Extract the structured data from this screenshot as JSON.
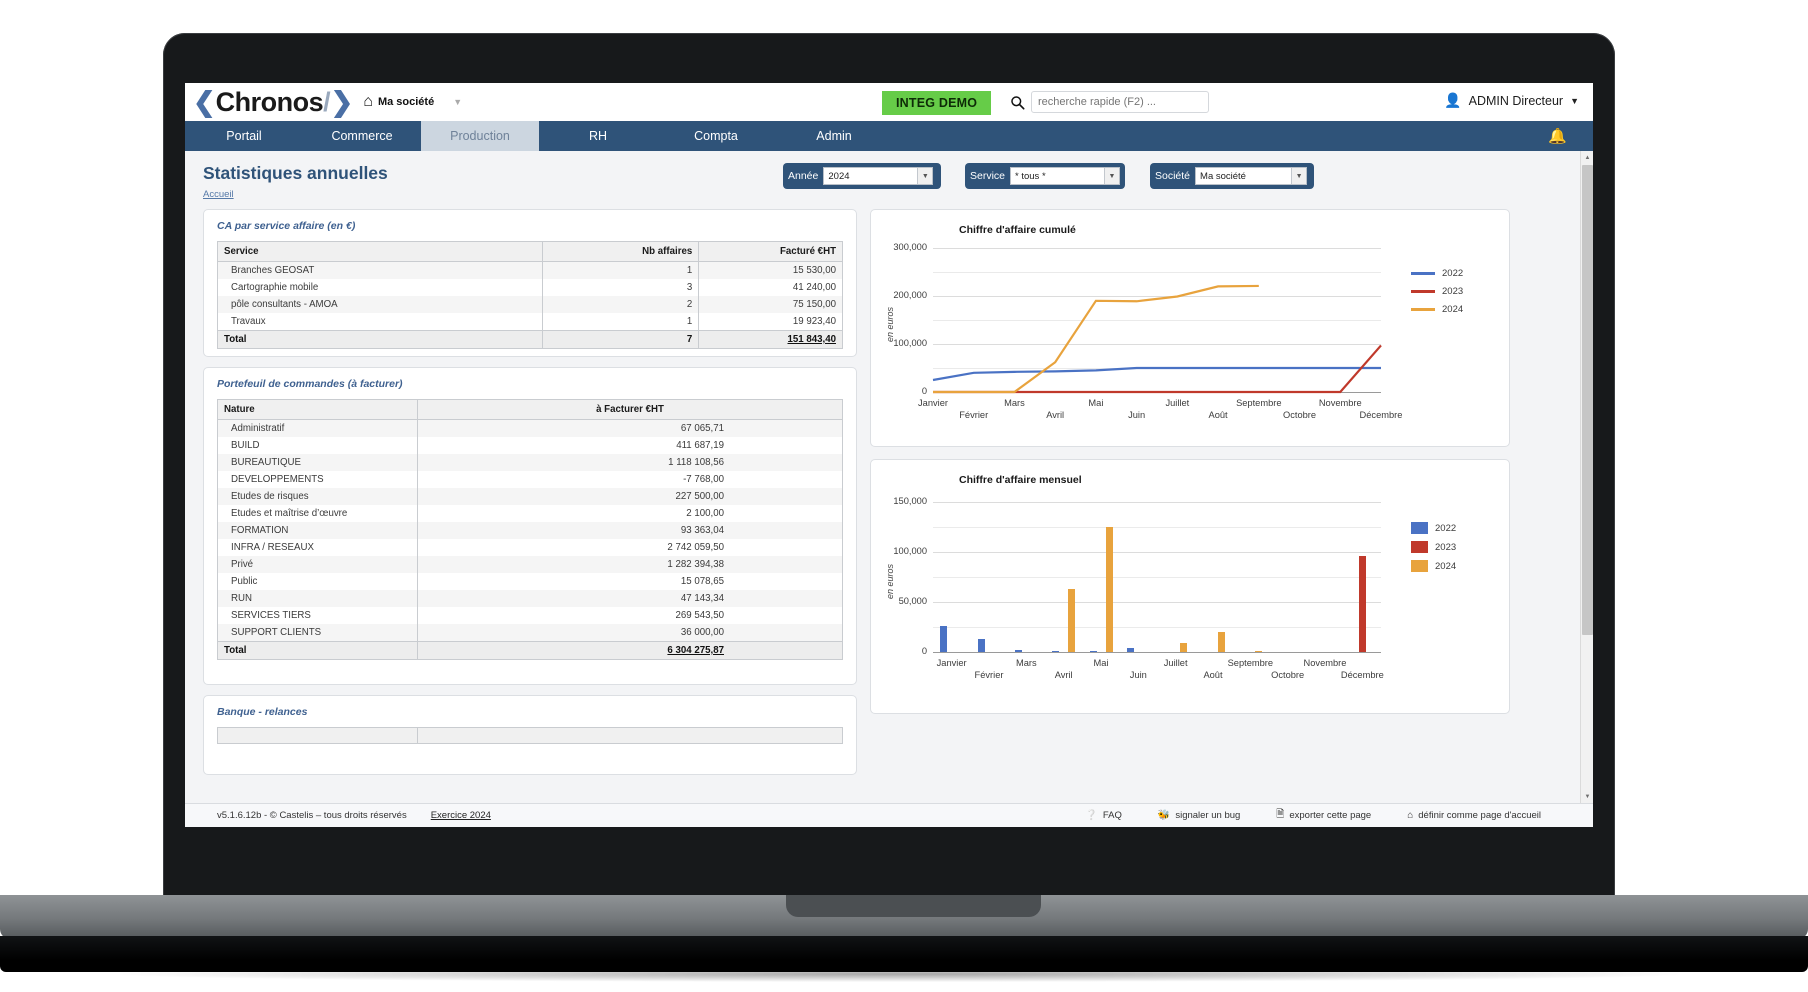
{
  "brand": {
    "logo_left_chevron": "❮",
    "logo_text": "Chronos",
    "logo_slash": "/",
    "logo_right_chevron": "❯",
    "company_label": "Ma société"
  },
  "topbar": {
    "integ_badge": "INTEG DEMO",
    "search_placeholder": "recherche rapide (F2) ...",
    "user_name": "ADMIN Directeur"
  },
  "nav": {
    "items": [
      {
        "label": "Portail",
        "active": false
      },
      {
        "label": "Commerce",
        "active": false
      },
      {
        "label": "Production",
        "active": true
      },
      {
        "label": "RH",
        "active": false
      },
      {
        "label": "Compta",
        "active": false
      },
      {
        "label": "Admin",
        "active": false
      }
    ]
  },
  "page": {
    "title": "Statistiques annuelles",
    "breadcrumb": "Accueil"
  },
  "filters": [
    {
      "label": "Année",
      "value": "2024"
    },
    {
      "label": "Service",
      "value": "* tous *"
    },
    {
      "label": "Société",
      "value": "Ma société"
    }
  ],
  "panel_ca": {
    "title": "CA par service affaire (en €)",
    "columns": [
      "Service",
      "Nb affaires",
      "Facturé €HT"
    ],
    "rows": [
      {
        "service": "Branches GEOSAT",
        "nb": "1",
        "facture": "15 530,00"
      },
      {
        "service": "Cartographie mobile",
        "nb": "3",
        "facture": "41 240,00"
      },
      {
        "service": "pôle consultants - AMOA",
        "nb": "2",
        "facture": "75 150,00"
      },
      {
        "service": "Travaux",
        "nb": "1",
        "facture": "19 923,40"
      }
    ],
    "total": {
      "label": "Total",
      "nb": "7",
      "facture": "151 843,40"
    }
  },
  "panel_portefeuille": {
    "title": "Portefeuil de commandes (à facturer)",
    "columns": [
      "Nature",
      "à Facturer €HT"
    ],
    "rows": [
      {
        "nature": "Administratif",
        "amount": "67 065,71"
      },
      {
        "nature": "BUILD",
        "amount": "411 687,19"
      },
      {
        "nature": "BUREAUTIQUE",
        "amount": "1 118 108,56"
      },
      {
        "nature": "DEVELOPPEMENTS",
        "amount": "-7 768,00"
      },
      {
        "nature": "Etudes de risques",
        "amount": "227 500,00"
      },
      {
        "nature": "Etudes et maîtrise d’œuvre",
        "amount": "2 100,00"
      },
      {
        "nature": "FORMATION",
        "amount": "93 363,04"
      },
      {
        "nature": "INFRA / RESEAUX",
        "amount": "2 742 059,50"
      },
      {
        "nature": "Privé",
        "amount": "1 282 394,38"
      },
      {
        "nature": "Public",
        "amount": "15 078,65"
      },
      {
        "nature": "RUN",
        "amount": "47 143,34"
      },
      {
        "nature": "SERVICES TIERS",
        "amount": "269 543,50"
      },
      {
        "nature": "SUPPORT CLIENTS",
        "amount": "36 000,00"
      }
    ],
    "total": {
      "label": "Total",
      "amount": "6 304 275,87"
    }
  },
  "panel_banque": {
    "title": "Banque - relances"
  },
  "chart_data": [
    {
      "type": "line",
      "title": "Chiffre d'affaire cumulé",
      "ylabel": "en euros",
      "xlabel": "",
      "categories": [
        "Janvier",
        "Février",
        "Mars",
        "Avril",
        "Mai",
        "Juin",
        "Juillet",
        "Août",
        "Septembre",
        "Octobre",
        "Novembre",
        "Décembre"
      ],
      "ytick_labels": [
        "0",
        "100,000",
        "200,000",
        "300,000"
      ],
      "ylim": [
        0,
        300000
      ],
      "grid": true,
      "legend_position": "right",
      "series": [
        {
          "name": "2022",
          "color": "#4a72c4",
          "values": [
            25000,
            40000,
            42000,
            43000,
            45000,
            50000,
            50000,
            50000,
            50000,
            50000,
            50000,
            50000
          ]
        },
        {
          "name": "2023",
          "color": "#c0392b",
          "values": [
            0,
            0,
            0,
            0,
            0,
            0,
            0,
            0,
            0,
            0,
            0,
            97000
          ]
        },
        {
          "name": "2024",
          "color": "#e8a33d",
          "values": [
            0,
            0,
            0,
            62000,
            190000,
            189000,
            199000,
            220000,
            221000,
            null,
            null,
            null
          ]
        }
      ]
    },
    {
      "type": "bar",
      "title": "Chiffre d'affaire mensuel",
      "ylabel": "en euros",
      "xlabel": "",
      "categories": [
        "Janvier",
        "Février",
        "Mars",
        "Avril",
        "Mai",
        "Juin",
        "Juillet",
        "Août",
        "Septembre",
        "Octobre",
        "Novembre",
        "Décembre"
      ],
      "ytick_labels": [
        "0",
        "50,000",
        "100,000",
        "150,000"
      ],
      "ylim": [
        0,
        150000
      ],
      "grid": true,
      "legend_position": "right",
      "series": [
        {
          "name": "2022",
          "color": "#4a72c4",
          "values": [
            26000,
            13500,
            2000,
            1500,
            400,
            4000,
            0,
            0,
            0,
            0,
            0,
            0
          ]
        },
        {
          "name": "2023",
          "color": "#c0392b",
          "values": [
            0,
            0,
            0,
            0,
            0,
            0,
            0,
            0,
            0,
            0,
            0,
            96500
          ]
        },
        {
          "name": "2024",
          "color": "#e8a33d",
          "values": [
            0,
            0,
            0,
            63500,
            125000,
            0,
            9500,
            20500,
            500,
            0,
            0,
            0
          ]
        }
      ]
    }
  ],
  "footer": {
    "version": "v5.1.6.12b - © Castelis – tous droits réservés",
    "exercice": "Exercice 2024",
    "links": [
      {
        "label": "FAQ",
        "icon": "question-circle-icon"
      },
      {
        "label": "signaler un bug",
        "icon": "bug-icon"
      },
      {
        "label": "exporter cette page",
        "icon": "export-icon"
      },
      {
        "label": "définir comme page d'accueil",
        "icon": "home-icon"
      }
    ]
  },
  "colors": {
    "nav_blue": "#2f5379",
    "badge_green": "#66cc48",
    "series_2022": "#4a72c4",
    "series_2023": "#c0392b",
    "series_2024": "#e8a33d"
  }
}
